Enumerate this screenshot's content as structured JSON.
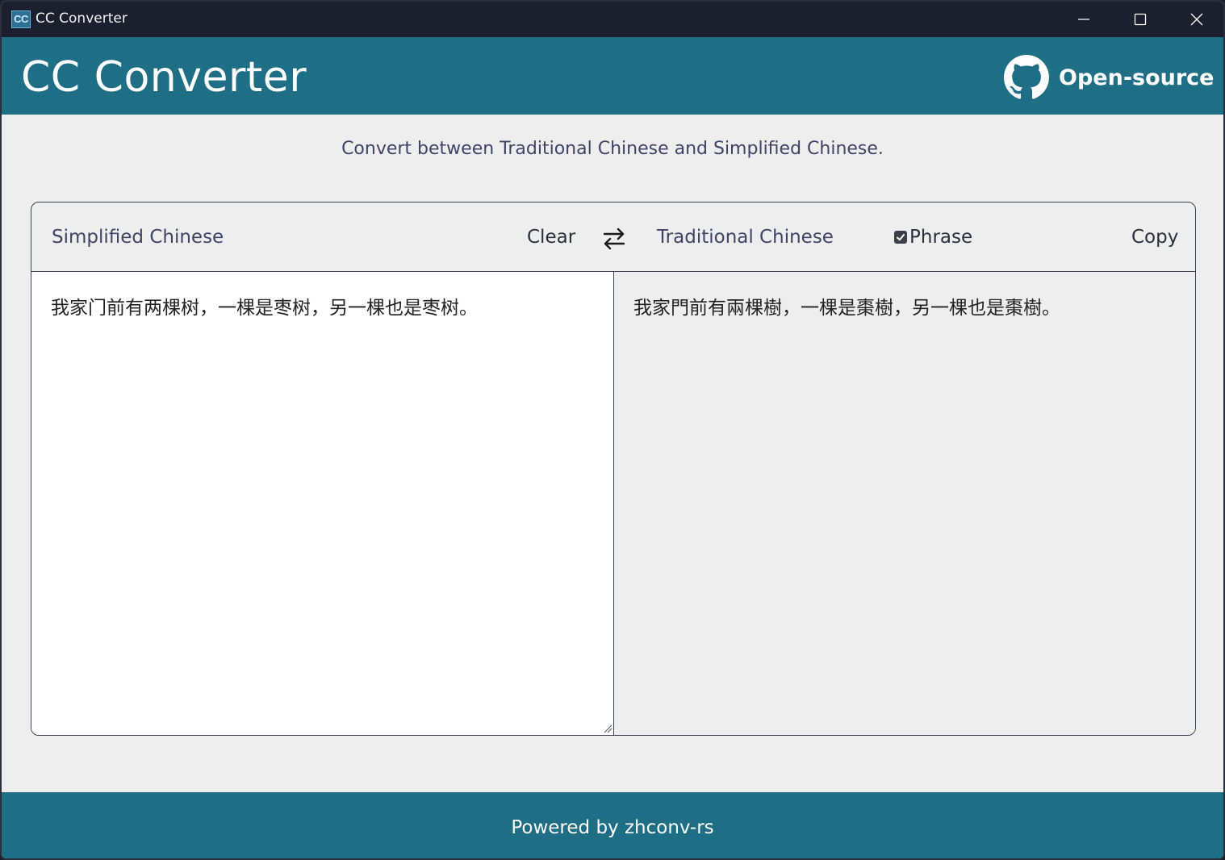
{
  "window": {
    "title": "CC Converter",
    "icon_text": "CC",
    "controls": [
      "minimize-icon",
      "maximize-icon",
      "close-icon"
    ]
  },
  "header": {
    "title": "CC Converter",
    "link_label": "Open-source",
    "link_icon": "github-icon"
  },
  "subtitle": "Convert between Traditional Chinese and Simplified Chinese.",
  "converter": {
    "source_label": "Simplified Chinese",
    "clear_label": "Clear",
    "swap_icon": "swap-arrows-icon",
    "target_label": "Traditional Chinese",
    "phrase_label": "Phrase",
    "phrase_checked": true,
    "copy_label": "Copy",
    "source_text": "我家门前有两棵树，一棵是枣树，另一棵也是枣树。",
    "target_text": "我家門前有兩棵樹，一棵是棗樹，另一棵也是棗樹。"
  },
  "footer": {
    "text": "Powered by zhconv-rs"
  },
  "colors": {
    "titlebar": "#1b1f2e",
    "brand": "#1e6e86",
    "background": "#eeeeee",
    "text_muted": "#3d4466"
  }
}
